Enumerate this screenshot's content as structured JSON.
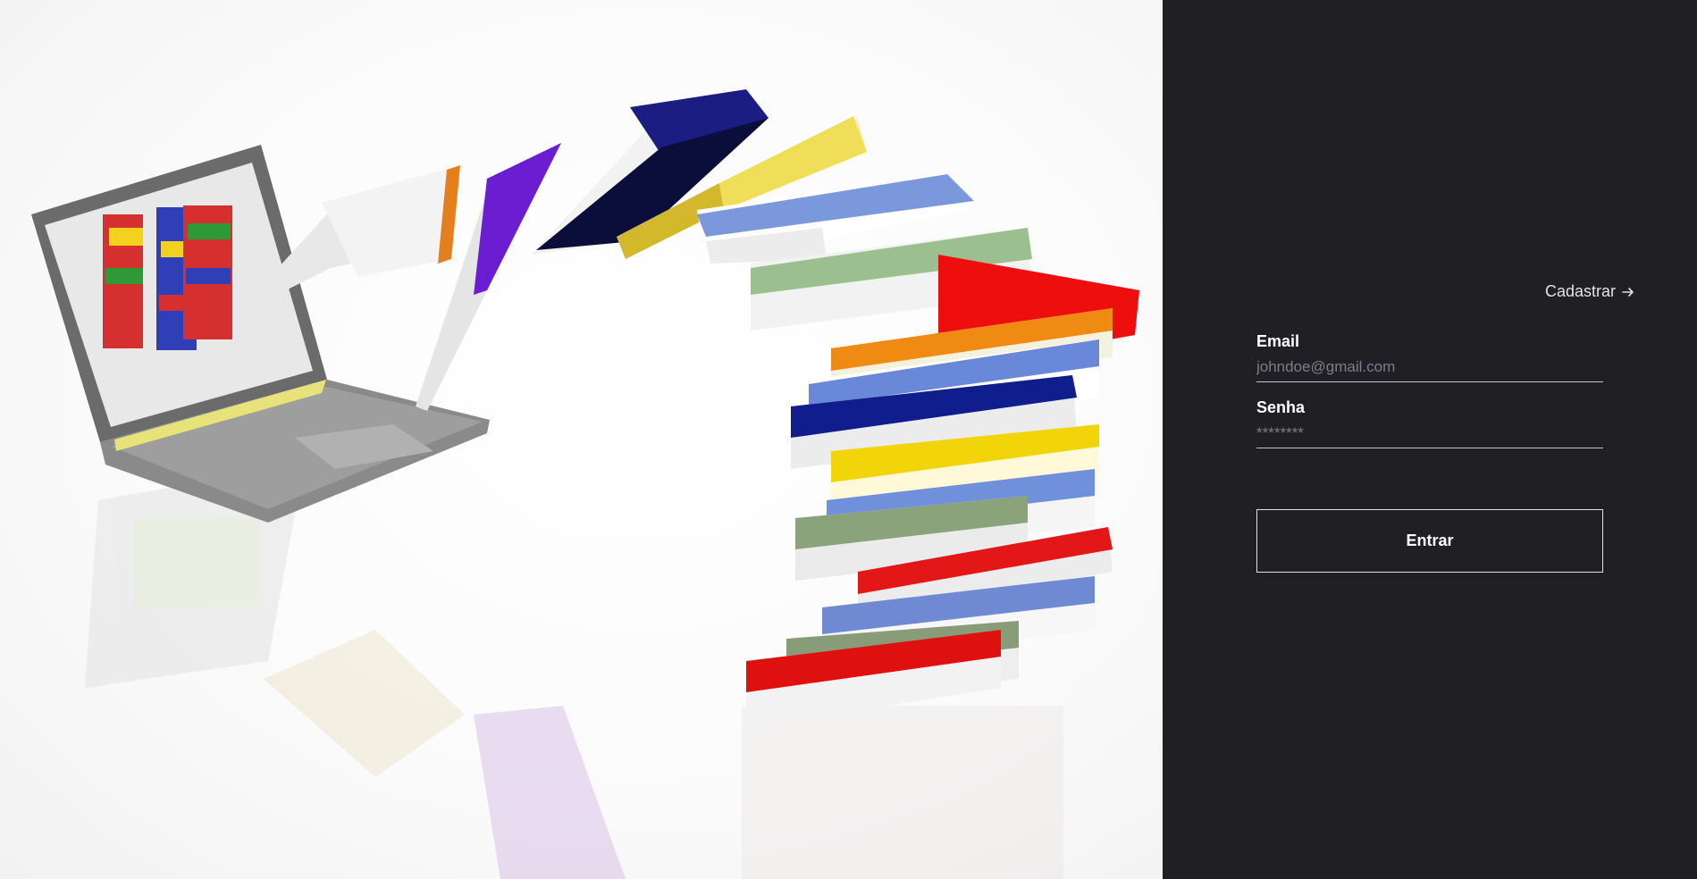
{
  "hero": {
    "image_name": "laptop-books-illustration"
  },
  "auth": {
    "signup_link": "Cadastrar",
    "email_label": "Email",
    "email_placeholder": "johndoe@gmail.com",
    "password_label": "Senha",
    "password_placeholder": "********",
    "submit_label": "Entrar"
  },
  "colors": {
    "panel_background": "#202024",
    "text_primary": "#ffffff",
    "text_secondary": "#e1e1e6",
    "placeholder": "#7c7c8a",
    "hero_background": "#ffffff"
  }
}
